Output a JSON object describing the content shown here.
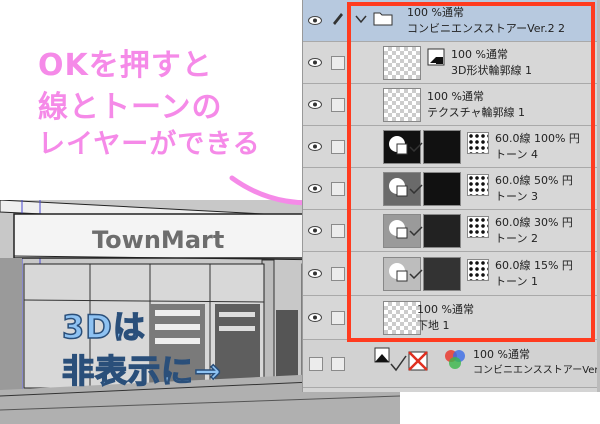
{
  "annotations": {
    "top_note": [
      "OKを押すと",
      "線とトーンの",
      "レイヤーができる"
    ],
    "bottom_note": [
      "3Dは",
      "非表示に→"
    ]
  },
  "scene": {
    "store_sign": "TownMart"
  },
  "layers": {
    "group": {
      "blend": "100 %通常",
      "name": "コンビニエンスストアーVer.2 2"
    },
    "shape_line": {
      "blend": "100 %通常",
      "name": "3D形状輪郭線 1"
    },
    "texture_line": {
      "blend": "100 %通常",
      "name": "テクスチャ輪郭線 1"
    },
    "tone4": {
      "line": "60.0線 100% 円",
      "name": "トーン 4"
    },
    "tone3": {
      "line": "60.0線 50% 円",
      "name": "トーン 3"
    },
    "tone2": {
      "line": "60.0線 30% 円",
      "name": "トーン 2"
    },
    "tone1": {
      "line": "60.0線 15% 円",
      "name": "トーン 1"
    },
    "base": {
      "blend": "100 %通常",
      "name": "下地 1"
    },
    "model3d": {
      "blend": "100 %通常",
      "name": "コンビニエンスストアーVer."
    }
  },
  "colors": {
    "highlight_frame": "#ff3b1f",
    "handwriting_pink": "#f58ae8",
    "handwriting_blue": "#8ec2f2",
    "selected_row": "#b7c9df"
  }
}
